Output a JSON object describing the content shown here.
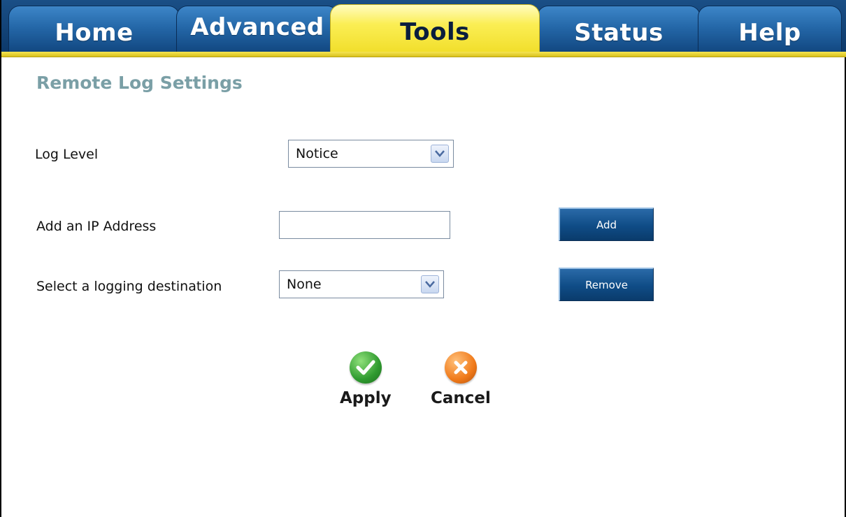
{
  "nav": {
    "tabs": [
      {
        "label": "Home"
      },
      {
        "label": "Advanced"
      },
      {
        "label": "Tools"
      },
      {
        "label": "Status"
      },
      {
        "label": "Help"
      }
    ],
    "active_tab": "Tools"
  },
  "page": {
    "title": "Remote Log Settings"
  },
  "form": {
    "log_level": {
      "label": "Log Level",
      "value": "Notice"
    },
    "ip_address": {
      "label": "Add an IP Address",
      "value": "",
      "placeholder": ""
    },
    "destination": {
      "label": "Select a logging destination",
      "value": "None"
    },
    "add_button": "Add",
    "remove_button": "Remove"
  },
  "actions": {
    "apply": "Apply",
    "cancel": "Cancel"
  },
  "colors": {
    "tab_blue": "#2467a8",
    "tab_active_yellow": "#fbee54",
    "title_teal": "#7a9fa6",
    "apply_green": "#2f9a2f",
    "cancel_orange": "#f07a1a"
  }
}
